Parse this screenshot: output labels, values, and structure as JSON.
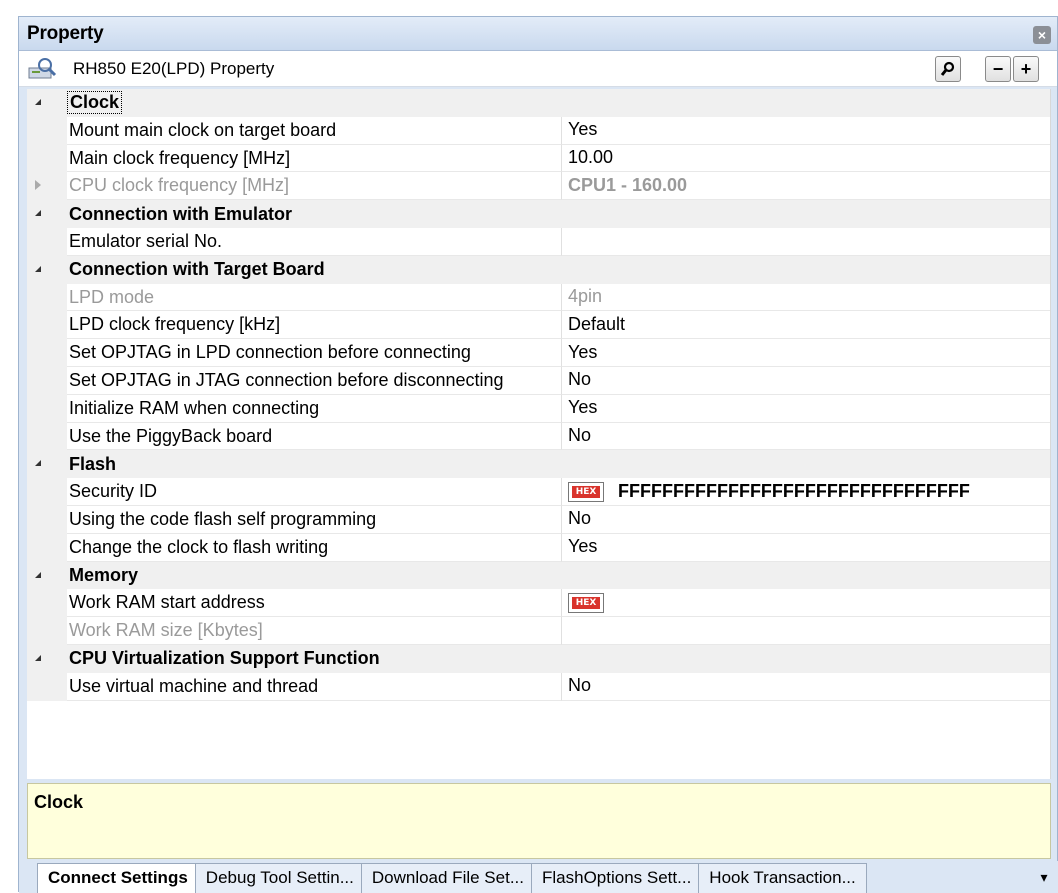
{
  "panel": {
    "title": "Property",
    "close_label": "×"
  },
  "header": {
    "title": "RH850 E20(LPD) Property",
    "search_label": "",
    "minus_label": "−",
    "plus_label": "+"
  },
  "categories": [
    {
      "label": "Clock",
      "rows": [
        {
          "name": "Mount main clock on target board",
          "value": "Yes"
        },
        {
          "name": "Main clock frequency [MHz]",
          "value": "10.00"
        },
        {
          "name": "CPU clock frequency [MHz]",
          "value": "CPU1 - 160.00"
        }
      ]
    },
    {
      "label": "Connection with Emulator",
      "rows": [
        {
          "name": "Emulator serial No.",
          "value": ""
        }
      ]
    },
    {
      "label": "Connection with Target Board",
      "rows": [
        {
          "name": "LPD mode",
          "value": "4pin"
        },
        {
          "name": "LPD clock frequency [kHz]",
          "value": "Default"
        },
        {
          "name": "Set OPJTAG in LPD connection before connecting",
          "value": "Yes"
        },
        {
          "name": "Set OPJTAG in JTAG connection before disconnecting",
          "value": "No"
        },
        {
          "name": "Initialize RAM when connecting",
          "value": "Yes"
        },
        {
          "name": "Use the PiggyBack board",
          "value": "No"
        }
      ]
    },
    {
      "label": "Flash",
      "rows": [
        {
          "name": "Security ID",
          "value": "FFFFFFFFFFFFFFFFFFFFFFFFFFFFFFFF",
          "hex": "HEX"
        },
        {
          "name": "Using the code flash self programming",
          "value": "No"
        },
        {
          "name": "Change the clock to flash writing",
          "value": "Yes"
        }
      ]
    },
    {
      "label": "Memory",
      "rows": [
        {
          "name": "Work RAM start address",
          "value": "",
          "hex": "HEX"
        },
        {
          "name": "Work RAM size [Kbytes]",
          "value": ""
        }
      ]
    },
    {
      "label": "CPU Virtualization Support Function",
      "rows": [
        {
          "name": "Use virtual machine and thread",
          "value": "No"
        }
      ]
    }
  ],
  "description": {
    "title": "Clock"
  },
  "tabs": [
    {
      "label": "Connect Settings"
    },
    {
      "label": "Debug Tool Settin..."
    },
    {
      "label": "Download File Set..."
    },
    {
      "label": "FlashOptions Sett..."
    },
    {
      "label": "Hook Transaction..."
    }
  ],
  "tab_menu": "▾"
}
